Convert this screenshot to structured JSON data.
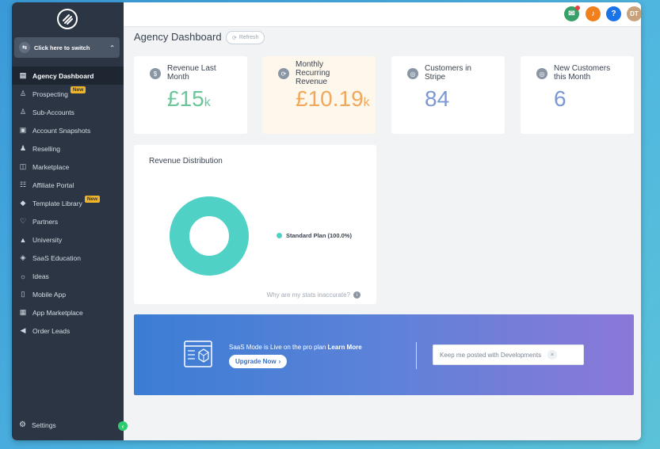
{
  "colors": {
    "sidebar_bg": "#2b3543",
    "green": "#6cc59a",
    "orange": "#f0a85b",
    "blue": "#7b97d4",
    "teal": "#4fd1c5"
  },
  "sidebar": {
    "switcher_label": "Click here to switch",
    "items": [
      {
        "label": "Agency Dashboard",
        "icon": "dashboard-icon",
        "active": true
      },
      {
        "label": "Prospecting",
        "icon": "prospecting-icon",
        "badge": "New"
      },
      {
        "label": "Sub-Accounts",
        "icon": "user-icon"
      },
      {
        "label": "Account Snapshots",
        "icon": "snapshot-icon"
      },
      {
        "label": "Reselling",
        "icon": "reselling-icon"
      },
      {
        "label": "Marketplace",
        "icon": "bag-icon"
      },
      {
        "label": "Affiliate Portal",
        "icon": "users-icon"
      },
      {
        "label": "Template Library",
        "icon": "template-icon",
        "badge": "New"
      },
      {
        "label": "Partners",
        "icon": "handshake-icon"
      },
      {
        "label": "University",
        "icon": "graduation-cap-icon"
      },
      {
        "label": "SaaS Education",
        "icon": "box-icon"
      },
      {
        "label": "Ideas",
        "icon": "lightbulb-icon"
      },
      {
        "label": "Mobile App",
        "icon": "mobile-icon"
      },
      {
        "label": "App Marketplace",
        "icon": "grid-icon"
      },
      {
        "label": "Order Leads",
        "icon": "megaphone-icon"
      }
    ],
    "settings_label": "Settings"
  },
  "topbar": {
    "avatar_initials": "DT",
    "help_label": "?"
  },
  "header": {
    "title": "Agency Dashboard",
    "refresh_label": "Refresh"
  },
  "stats": [
    {
      "label": "Revenue Last Month",
      "value": "£15",
      "unit": "k",
      "icon": "dollar-icon",
      "color": "#6cc59a"
    },
    {
      "label": "Monthly Recurring Revenue",
      "value": "£10.19",
      "unit": "k",
      "icon": "recurring-icon",
      "color": "#f0a85b"
    },
    {
      "label": "Customers in Stripe",
      "value": "84",
      "unit": "",
      "icon": "stripe-customer-icon",
      "color": "#7b97d4"
    },
    {
      "label": "New Customers this Month",
      "value": "6",
      "unit": "",
      "icon": "new-customer-icon",
      "color": "#7b97d4"
    }
  ],
  "revenue_distribution": {
    "title": "Revenue Distribution",
    "legend_label": "Standard Plan (100.0%)",
    "stats_link": "Why are my stats inaccurate?",
    "chart_data": {
      "type": "pie",
      "categories": [
        "Standard Plan"
      ],
      "values": [
        100.0
      ],
      "title": "Revenue Distribution",
      "legend": "right"
    }
  },
  "banner": {
    "text_prefix": "SaaS Mode is Live on the pro plan",
    "learn_more": "Learn More",
    "upgrade_label": "Upgrade Now",
    "notify_label": "Keep me posted with Developments"
  }
}
